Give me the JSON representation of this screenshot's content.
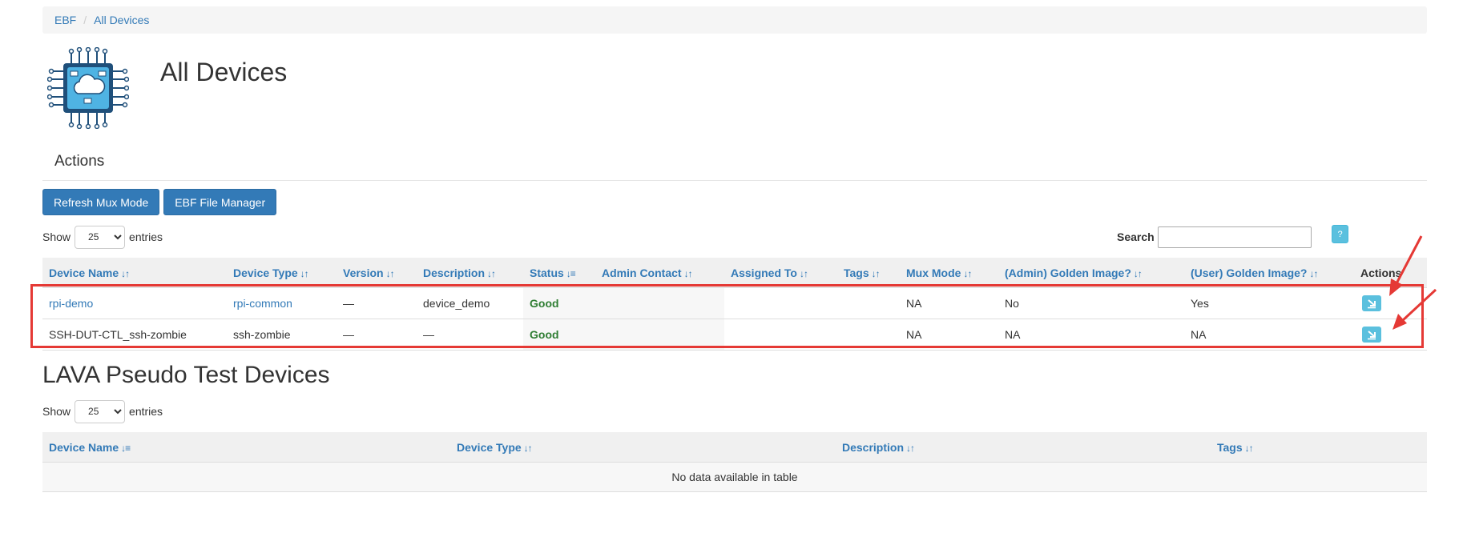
{
  "breadcrumb": {
    "root": "EBF",
    "current": "All Devices"
  },
  "header": {
    "title": "All Devices",
    "logo_icon": "chip-cloud-icon"
  },
  "actions": {
    "title": "Actions",
    "buttons": [
      "Refresh Mux Mode",
      "EBF File Manager"
    ]
  },
  "devices_table": {
    "show_label": "Show",
    "page_size": "25",
    "entries_label": "entries",
    "search_label": "Search",
    "search_value": "",
    "help_label": "?",
    "columns": [
      "Device Name",
      "Device Type",
      "Version",
      "Description",
      "Status",
      "Admin Contact",
      "Assigned To",
      "Tags",
      "Mux Mode",
      "(Admin) Golden Image?",
      "(User) Golden Image?",
      "Actions"
    ],
    "rows": [
      {
        "name": "rpi-demo",
        "type": "rpi-common",
        "version": "—",
        "description": "device_demo",
        "status": "Good",
        "admin": "",
        "assigned": "",
        "tags": "",
        "mux": "NA",
        "admin_golden": "No",
        "user_golden": "Yes"
      },
      {
        "name": "SSH-DUT-CTL_ssh-zombie",
        "type": "ssh-zombie",
        "version": "—",
        "description": "—",
        "status": "Good",
        "admin": "",
        "assigned": "",
        "tags": "",
        "mux": "NA",
        "admin_golden": "NA",
        "user_golden": "NA"
      }
    ]
  },
  "pseudo": {
    "title": "LAVA Pseudo Test Devices",
    "show_label": "Show",
    "page_size": "25",
    "entries_label": "entries",
    "columns": [
      "Device Name",
      "Device Type",
      "Description",
      "Tags"
    ],
    "empty_message": "No data available in table"
  },
  "colors": {
    "link": "#337ab7",
    "status_good": "#2e7d32",
    "annotation": "#e53935",
    "info": "#5bc0de"
  }
}
